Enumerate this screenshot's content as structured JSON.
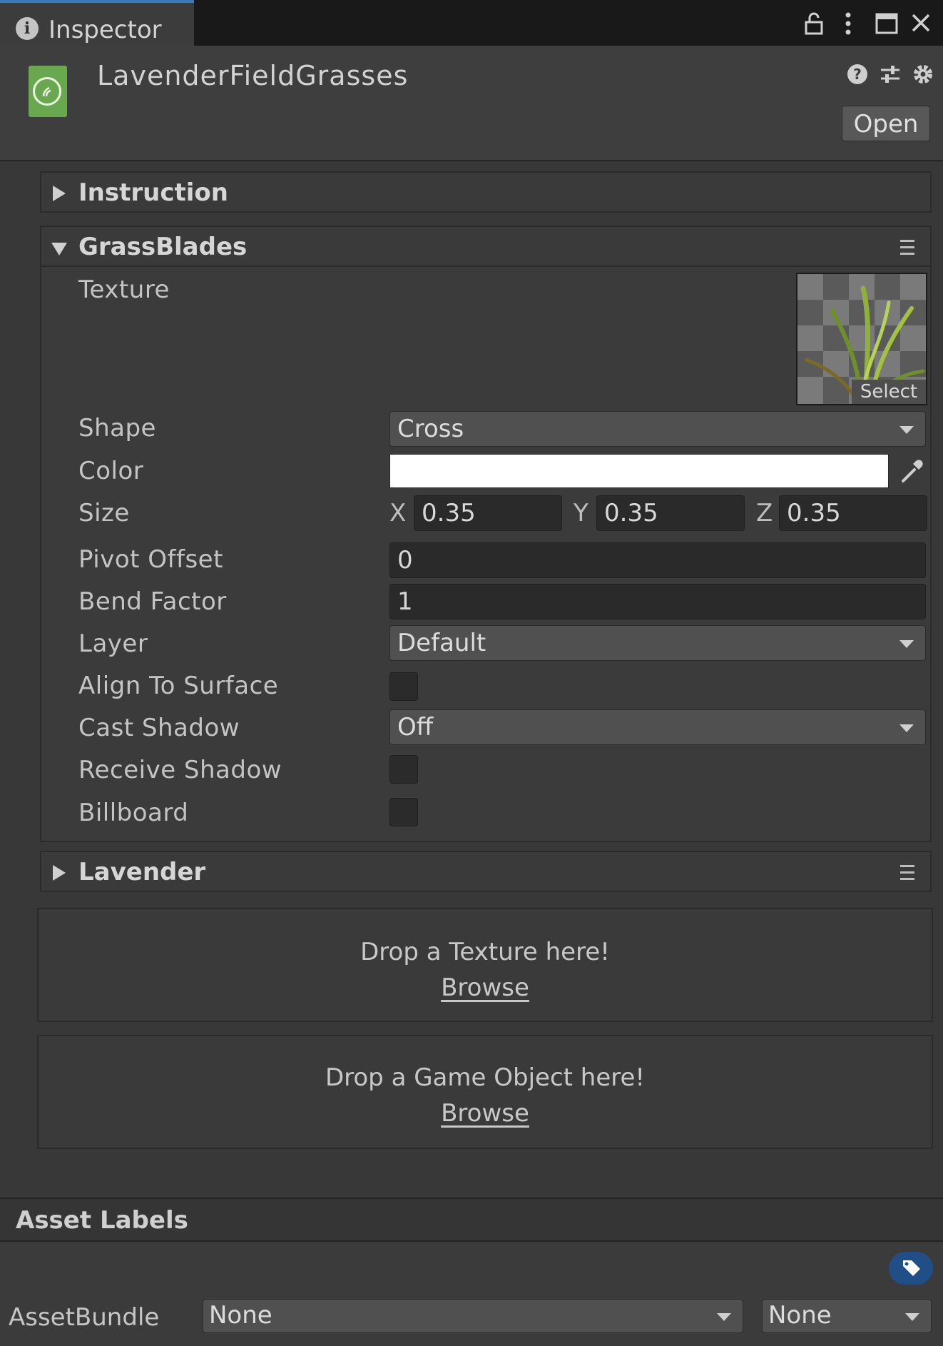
{
  "tab": {
    "title": "Inspector"
  },
  "window_icons": [
    "lock-icon",
    "more-icon",
    "maximize-icon",
    "close-icon"
  ],
  "header": {
    "asset_name": "LavenderFieldGrasses",
    "icons": [
      "help-icon",
      "presets-icon",
      "settings-icon"
    ],
    "open_label": "Open"
  },
  "sections": {
    "instruction": {
      "title": "Instruction",
      "expanded": false
    },
    "grassblades": {
      "title": "GrassBlades",
      "expanded": true,
      "texture_label": "Texture",
      "texture_select_label": "Select",
      "shape": {
        "label": "Shape",
        "value": "Cross"
      },
      "color": {
        "label": "Color",
        "value": "#ffffff"
      },
      "size": {
        "label": "Size",
        "x_label": "X",
        "x": "0.35",
        "y_label": "Y",
        "y": "0.35",
        "z_label": "Z",
        "z": "0.35"
      },
      "pivot_offset": {
        "label": "Pivot Offset",
        "value": "0"
      },
      "bend_factor": {
        "label": "Bend Factor",
        "value": "1"
      },
      "layer": {
        "label": "Layer",
        "value": "Default"
      },
      "align_to_surface": {
        "label": "Align To Surface",
        "checked": false
      },
      "cast_shadow": {
        "label": "Cast Shadow",
        "value": "Off"
      },
      "receive_shadow": {
        "label": "Receive Shadow",
        "checked": false
      },
      "billboard": {
        "label": "Billboard",
        "checked": false
      }
    },
    "lavender": {
      "title": "Lavender",
      "expanded": false
    }
  },
  "drop_texture": {
    "text": "Drop a Texture here!",
    "browse": "Browse"
  },
  "drop_gameobject": {
    "text": "Drop a Game Object here!",
    "browse": "Browse"
  },
  "asset_labels": {
    "title": "Asset Labels",
    "assetbundle_label": "AssetBundle",
    "assetbundle_value": "None",
    "variant_value": "None"
  },
  "colors": {
    "accent": "#3a79bb",
    "asset_icon": "#6aa84f",
    "tag_button": "#1f4f86"
  }
}
